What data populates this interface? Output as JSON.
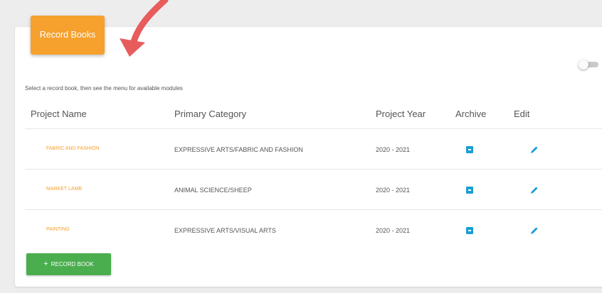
{
  "header": {
    "title": "Record Books"
  },
  "instructions": "Select a record book, then see the menu for available modules",
  "table": {
    "columns": [
      "Project Name",
      "Primary Category",
      "Project Year",
      "Archive",
      "Edit"
    ],
    "rows": [
      {
        "name": "FABRIC AND FASHION",
        "category": "EXPRESSIVE ARTS/FABRIC AND FASHION",
        "year": "2020 - 2021"
      },
      {
        "name": "MARKET LAMB",
        "category": "ANIMAL SCIENCE/SHEEP",
        "year": "2020 - 2021"
      },
      {
        "name": "PAINTING",
        "category": "EXPRESSIVE ARTS/VISUAL ARTS",
        "year": "2020 - 2021"
      }
    ]
  },
  "add_button": {
    "icon": "+",
    "label": "RECORD BOOK"
  },
  "icons": {
    "archive": "archive-icon",
    "edit": "pencil-icon",
    "toggle": "toggle-switch",
    "annotation": "red-curved-arrow"
  },
  "colors": {
    "accent_orange": "#f6a02d",
    "archive_blue": "#1a9ed4",
    "add_green": "#4aae4f",
    "arrow_red": "#e85c5c"
  },
  "toggle": {
    "on": false
  }
}
